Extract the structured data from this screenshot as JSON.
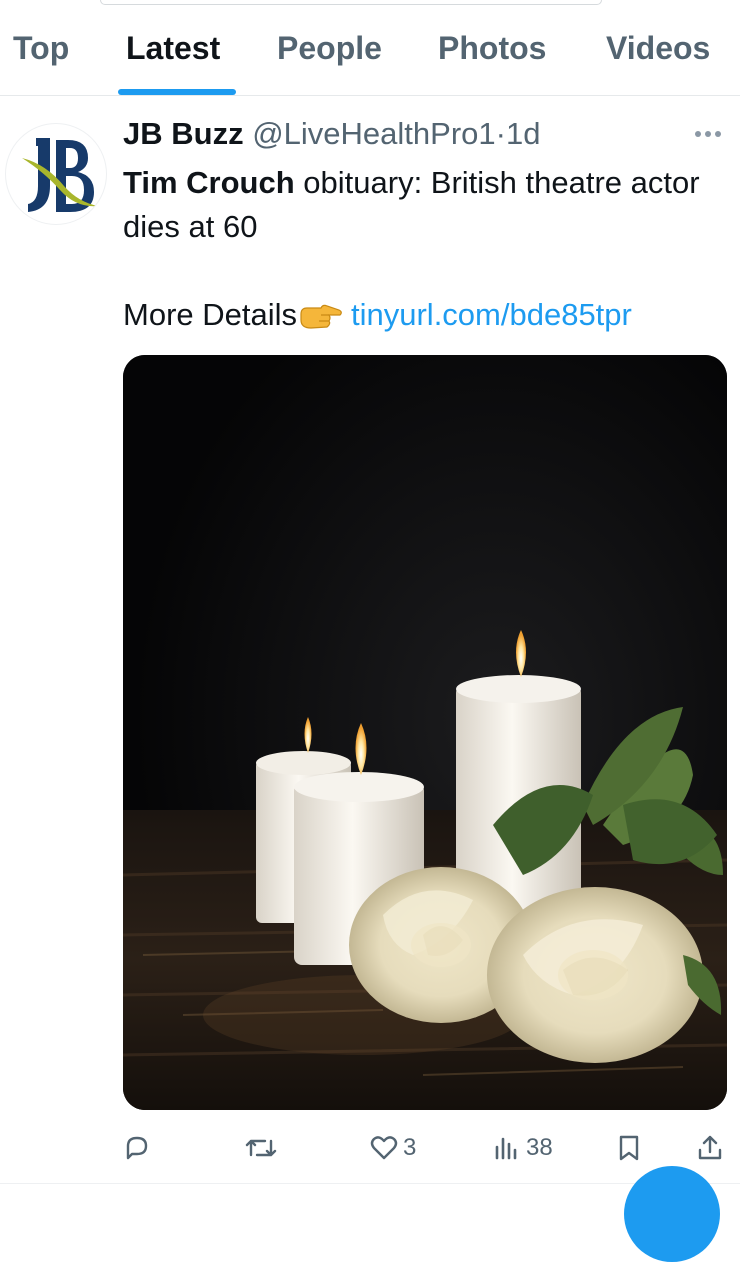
{
  "tabs": [
    {
      "label": "Top",
      "active": false
    },
    {
      "label": "Latest",
      "active": true
    },
    {
      "label": "People",
      "active": false
    },
    {
      "label": "Photos",
      "active": false
    },
    {
      "label": "Videos",
      "active": false
    }
  ],
  "tweet": {
    "author_name": "JB Buzz",
    "handle": "@LiveHealthPro1",
    "separator": "·",
    "age": "1d",
    "text_bold": "Tim Crouch",
    "text_rest": " obituary: British theatre actor dies at 60",
    "details_label": "More Details",
    "link": "tinyurl.com/bde85tpr",
    "avatar_logo": "JB",
    "emoji": "pointing-hand-icon",
    "media_alt": "Three white candles and white roses on a dark wooden table"
  },
  "actions": {
    "reply_count": "",
    "retweet_count": "",
    "like_count": "3",
    "views_count": "38"
  },
  "colors": {
    "accent": "#1d9bf0",
    "text": "#0f1419",
    "muted": "#536471"
  }
}
